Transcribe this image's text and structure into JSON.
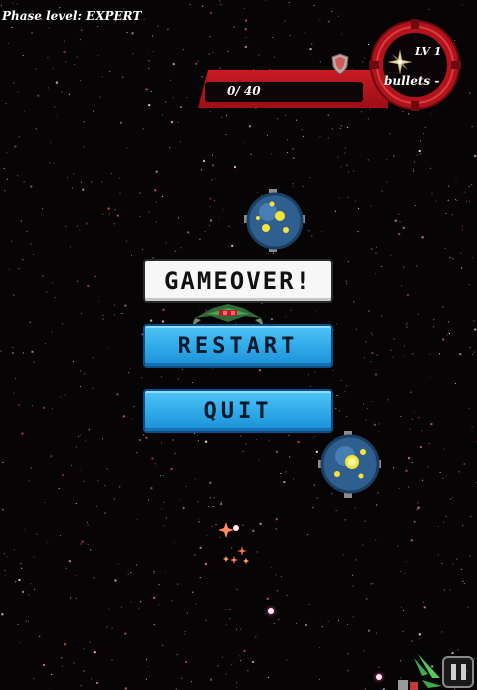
{
  "hud": {
    "phase_level": "Phase level: EXPERT",
    "score": "0/ 40",
    "level": "LV 1",
    "bullets": "bullets -"
  },
  "dialog": {
    "title": "GAMEOVER!",
    "restart_label": "RESTART",
    "quit_label": "QUIT"
  },
  "icons": {
    "shield": "shield-icon",
    "weapon": "shuriken-icon",
    "pause": "pause-icon"
  },
  "colors": {
    "hud_red": "#c91a22",
    "button_blue": "#2fa8e8",
    "panel_white": "#f7f7f7"
  }
}
